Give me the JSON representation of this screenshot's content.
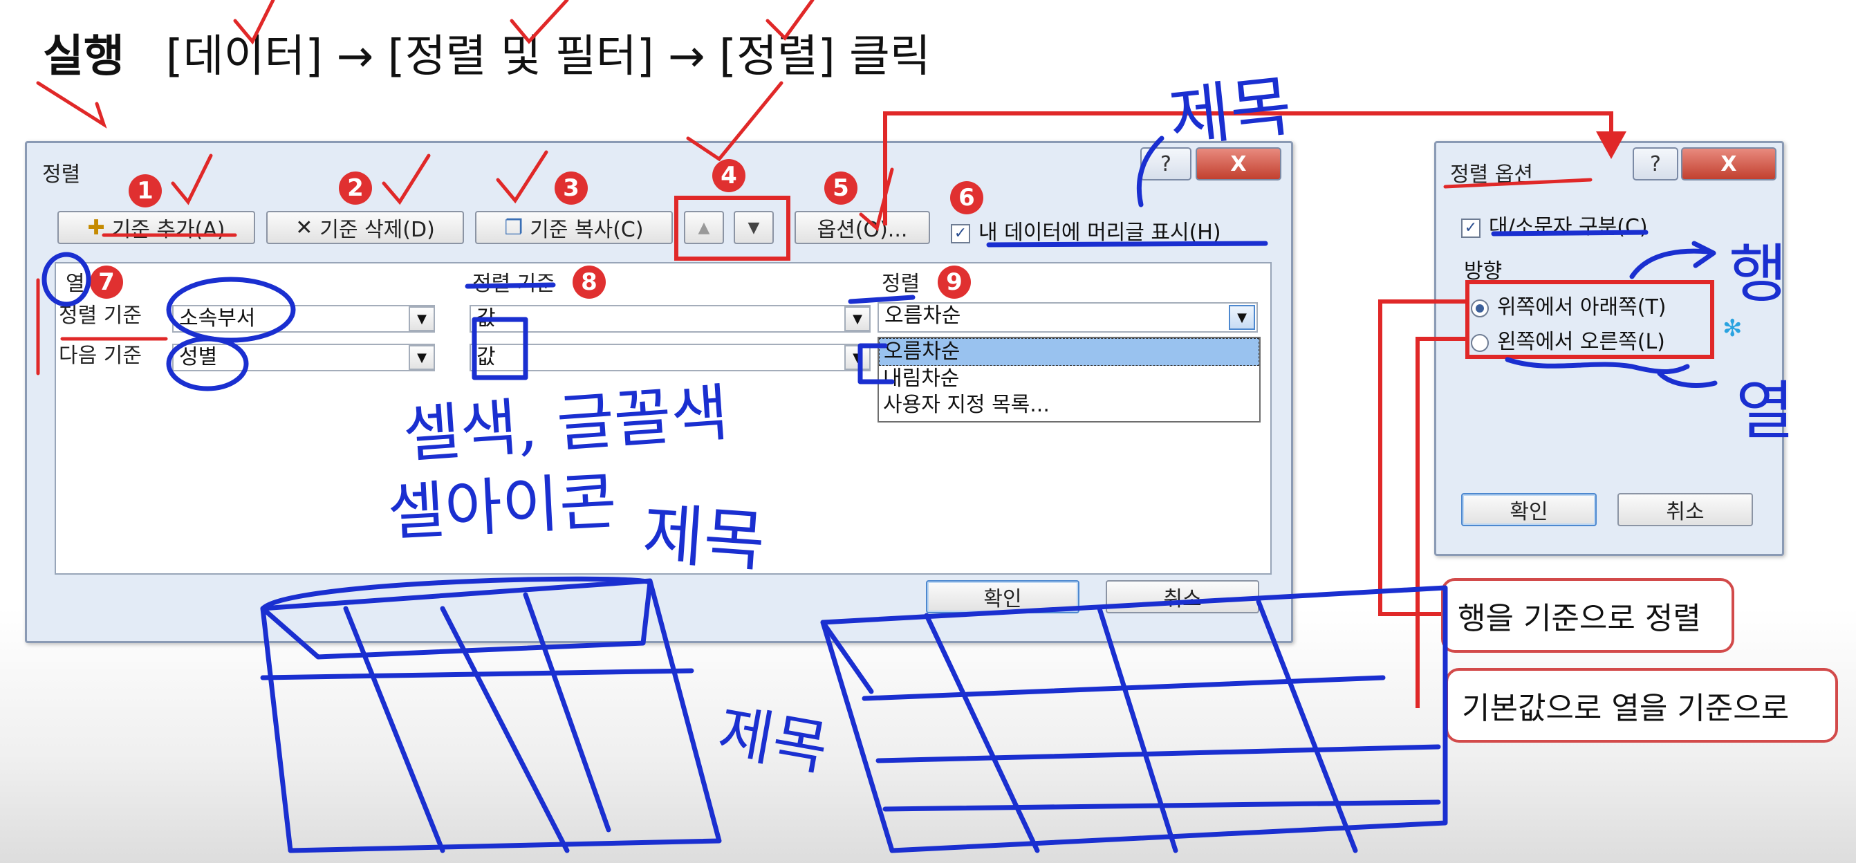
{
  "headline": {
    "bold": "실행",
    "path": "[데이터] → [정렬 및 필터] → [정렬] 클릭"
  },
  "sort_dialog": {
    "title": "정렬",
    "help": "?",
    "close": "X",
    "toolbar": {
      "add_level": "기준 추가(A)",
      "delete_level": "기준 삭제(D)",
      "copy_level": "기준 복사(C)",
      "move_up": "▲",
      "move_down": "▼",
      "options": "옵션(O)...",
      "header_checkbox": "내 데이터에 머리글 표시(H)"
    },
    "columns": {
      "column": "열",
      "sort_on": "정렬 기준",
      "order": "정렬"
    },
    "rows": [
      {
        "label": "정렬 기준",
        "column": "소속부서",
        "sort_on": "값",
        "order": "오름차순"
      },
      {
        "label": "다음 기준",
        "column": "성별",
        "sort_on": "값",
        "order": ""
      }
    ],
    "order_options": [
      "오름차순",
      "내림차순",
      "사용자 지정 목록..."
    ],
    "ok": "확인",
    "cancel": "취소"
  },
  "options_dialog": {
    "title": "정렬 옵션",
    "help": "?",
    "close": "X",
    "case_sensitive": "대/소문자 구분(C)",
    "direction_label": "방향",
    "top_to_bottom": "위쪽에서 아래쪽(T)",
    "left_to_right": "왼쪽에서 오른쪽(L)",
    "ok": "확인",
    "cancel": "취소"
  },
  "badges": [
    "1",
    "2",
    "3",
    "4",
    "5",
    "6",
    "7",
    "8",
    "9"
  ],
  "callouts": {
    "by_row": "행을 기준으로 정렬",
    "by_column": "기본값으로 열을 기준으로"
  },
  "handwriting": {
    "title1": "제목",
    "title2": "제목",
    "title3": "제목",
    "row": "행",
    "col": "열",
    "note1": "셀색, 글꼴색",
    "note2": "셀아이콘"
  },
  "colors": {
    "ink_blue": "#1a2fd0",
    "ink_red": "#e02828",
    "accent_red": "#d24a4a"
  }
}
